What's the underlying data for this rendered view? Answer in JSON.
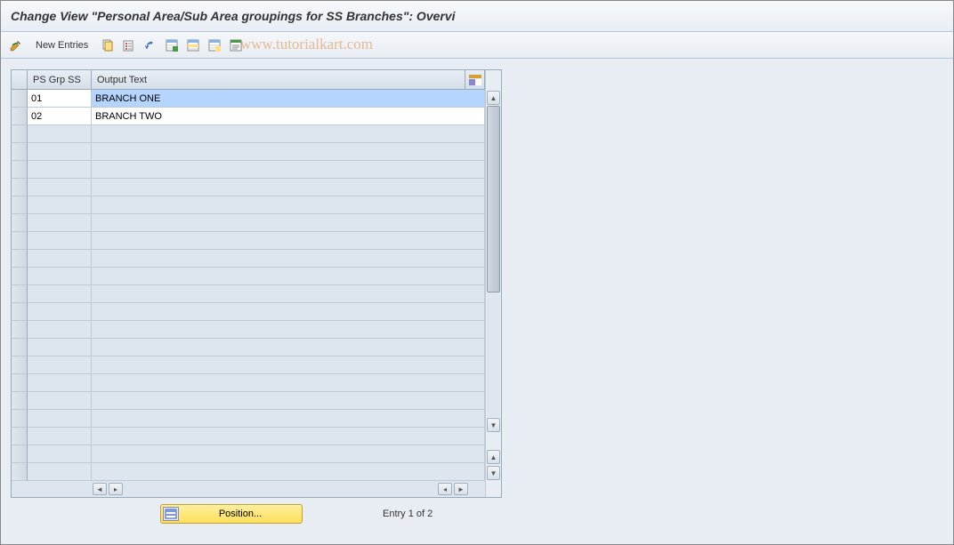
{
  "title": "Change View \"Personal Area/Sub Area groupings for SS Branches\": Overvi",
  "toolbar": {
    "new_entries_label": "New Entries"
  },
  "watermark": "www.tutorialkart.com",
  "grid": {
    "columns": {
      "ps_grp": "PS Grp SS",
      "output_text": "Output Text"
    },
    "rows": [
      {
        "ps": "01",
        "output": "BRANCH ONE",
        "selected": true
      },
      {
        "ps": "02",
        "output": "BRANCH TWO",
        "selected": false
      }
    ],
    "empty_row_count": 20
  },
  "footer": {
    "position_label": "Position...",
    "entry_text": "Entry 1 of 2"
  }
}
